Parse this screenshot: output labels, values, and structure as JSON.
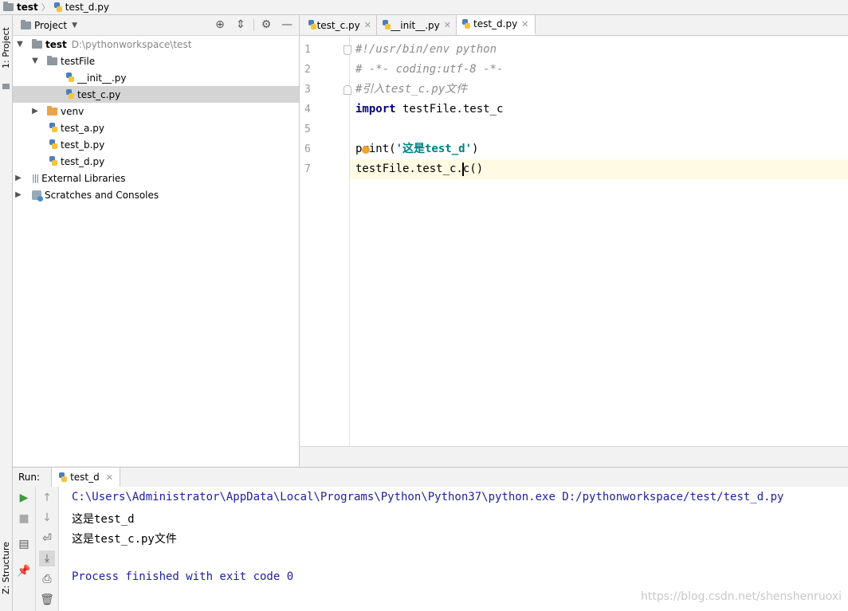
{
  "breadcrumb": {
    "project": "test",
    "file": "test_d.py"
  },
  "left_strip": {
    "project_tab": "1: Project",
    "structure_tab": "Z: Structure"
  },
  "project_panel": {
    "title": "Project",
    "tree": [
      {
        "label": "test",
        "hint": "D:\\pythonworkspace\\test"
      },
      {
        "label": "testFile"
      },
      {
        "label": "__init__.py"
      },
      {
        "label": "test_c.py"
      },
      {
        "label": "venv"
      },
      {
        "label": "test_a.py"
      },
      {
        "label": "test_b.py"
      },
      {
        "label": "test_d.py"
      },
      {
        "label": "External Libraries"
      },
      {
        "label": "Scratches and Consoles"
      }
    ]
  },
  "editor_tabs": [
    {
      "label": "test_c.py"
    },
    {
      "label": "__init__.py"
    },
    {
      "label": "test_d.py"
    }
  ],
  "editor": {
    "line_numbers": [
      "1",
      "2",
      "3",
      "4",
      "5",
      "6",
      "7"
    ],
    "code": {
      "l1": "#!/usr/bin/env python",
      "l2": "# -*- coding:utf-8 -*-",
      "l3": "#引入test_c.py文件",
      "l4_kw": "import",
      "l4_rest": " testFile.test_c",
      "l6_a": "print(",
      "l6_str": "'这是test_d'",
      "l6_b": ")",
      "l7_a": "testFile.test_c.",
      "l7_b": "c()"
    }
  },
  "run": {
    "label": "Run:",
    "tab": "test_d",
    "output": [
      "C:\\Users\\Administrator\\AppData\\Local\\Programs\\Python\\Python37\\python.exe D:/pythonworkspace/test/test_d.py",
      "这是test_d",
      "这是test_c.py文件",
      "Process finished with exit code 0"
    ]
  },
  "watermark": "https://blog.csdn.net/shenshenruoxi",
  "colors": {
    "keyword": "#000080",
    "string": "#008080",
    "comment": "#8c8c8c",
    "console_blue": "#2020a0",
    "line_highlight": "#fffae3"
  }
}
